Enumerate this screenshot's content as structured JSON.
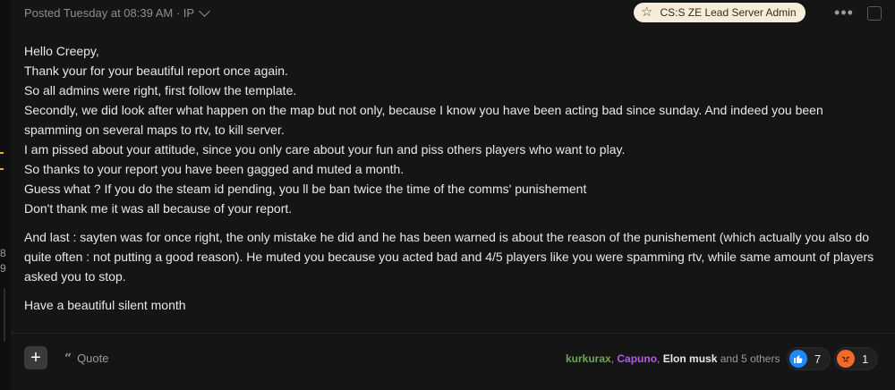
{
  "post": {
    "header": {
      "posted_text": "Posted Tuesday at 08:39 AM · IP",
      "badge_label": "CS:S ZE Lead Server Admin",
      "badge_icon": "star-icon",
      "more_icon": "more-dots-icon",
      "select_icon": "checkbox"
    },
    "content": {
      "lines_1": [
        "Hello Creepy,",
        "Thank your for your beautiful report once again.",
        "So all admins were right, first follow the template.",
        "Secondly, we did look after what happen on the map but not only, because I know you have been acting bad since sunday. And indeed you been spamming on several maps to rtv, to kill server.",
        "I am pissed about your attitude, since you only care about your fun and piss others players who want to play.",
        "So thanks to your report you have been gagged and muted a month.",
        "Guess what ? If you do the steam id pending, you ll be ban twice the time of the comms' punishement",
        "Don't thank me it was all because of your report."
      ],
      "paragraph_2": "And last : sayten was for once right, the only mistake he did and he has been warned is about the reason of the punishement (which actually you also do quite often : not putting a good reason). He muted you because you acted bad and 4/5 players like you were spamming rtv, while same amount of players asked you to stop.",
      "paragraph_3": "Have a beautiful silent month"
    },
    "footer": {
      "plus_label": "+",
      "quote_label": "Quote",
      "quote_icon": "quote-icon",
      "reactors": {
        "user1": "kurkurax",
        "sep1": ", ",
        "user2": "Capuno",
        "sep2": ", ",
        "user3": "Elon musk",
        "rest": " and 5 others"
      },
      "reactions": [
        {
          "icon": "thumbs-up-icon",
          "count": "7"
        },
        {
          "icon": "angry-face-icon",
          "count": "1"
        }
      ]
    }
  },
  "left_edge": {
    "marks": [
      "8",
      "9"
    ]
  },
  "colors": {
    "background": "#151515",
    "badge_bg": "#f6ecdc",
    "like_blue": "#1e88ff",
    "angry_orange": "#f06a2a",
    "user1_green": "#6aa84f",
    "user2_purple": "#b45ce6"
  }
}
